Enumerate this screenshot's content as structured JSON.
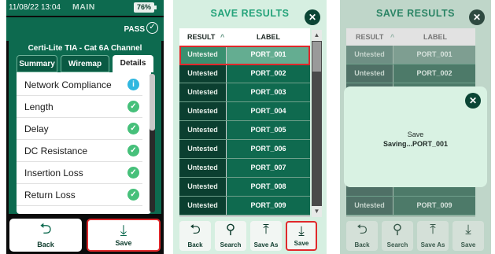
{
  "panel1": {
    "status": {
      "datetime": "11/08/22 13:04",
      "mode": "MAIN",
      "battery": "76%"
    },
    "result": {
      "label": "PASS",
      "icon": "check-circle-icon"
    },
    "cable": "Certi-Lite TIA - Cat 6A Channel",
    "tabs": [
      "Summary",
      "Wiremap",
      "Details"
    ],
    "active_tab": "Details",
    "tests": [
      {
        "label": "Network Compliance",
        "icon": "info-icon"
      },
      {
        "label": "Length",
        "icon": "check-icon"
      },
      {
        "label": "Delay",
        "icon": "check-icon"
      },
      {
        "label": "DC Resistance",
        "icon": "check-icon"
      },
      {
        "label": "Insertion Loss",
        "icon": "check-icon"
      },
      {
        "label": "Return Loss",
        "icon": "check-icon"
      }
    ],
    "buttons": {
      "back": "Back",
      "save": "Save"
    }
  },
  "save_results": {
    "title": "SAVE RESULTS",
    "columns": {
      "result": "RESULT",
      "label": "LABEL",
      "sort_glyph": "^"
    },
    "rows": [
      {
        "result": "Untested",
        "label": "PORT_001"
      },
      {
        "result": "Untested",
        "label": "PORT_002"
      },
      {
        "result": "Untested",
        "label": "PORT_003"
      },
      {
        "result": "Untested",
        "label": "PORT_004"
      },
      {
        "result": "Untested",
        "label": "PORT_005"
      },
      {
        "result": "Untested",
        "label": "PORT_006"
      },
      {
        "result": "Untested",
        "label": "PORT_007"
      },
      {
        "result": "Untested",
        "label": "PORT_008"
      },
      {
        "result": "Untested",
        "label": "PORT_009"
      }
    ],
    "buttons": {
      "back": "Back",
      "search": "Search",
      "save_as": "Save As",
      "save": "Save"
    }
  },
  "panel3": {
    "rows": [
      {
        "result": "Untested",
        "label": "PORT_001"
      },
      {
        "result": "Untested",
        "label": "PORT_002"
      },
      {
        "result": "Untested",
        "label": "PORT_009"
      }
    ],
    "dialog": {
      "title": "Save",
      "message": "Saving...PORT_001"
    }
  },
  "colors": {
    "brand": "#0d6a4f",
    "highlight": "#e0282b",
    "pass": "#46c07a",
    "info": "#31b7df"
  }
}
